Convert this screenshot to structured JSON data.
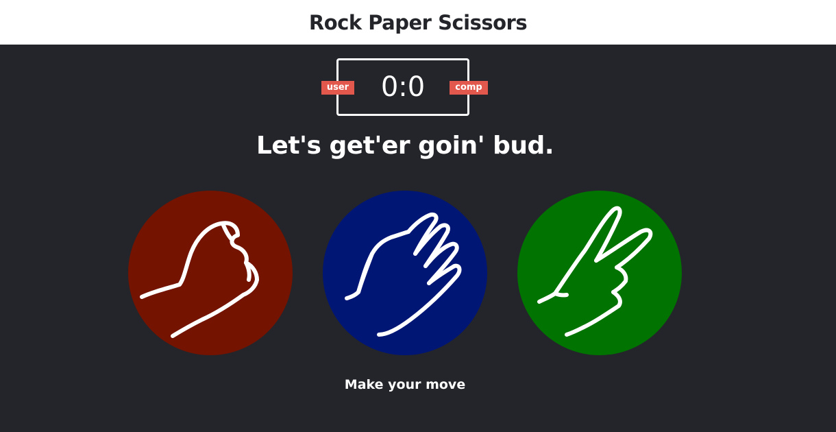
{
  "header": {
    "title": "Rock Paper Scissors"
  },
  "scoreboard": {
    "user_label": "user",
    "comp_label": "comp",
    "score": "0:0",
    "badge_color": "#e2584d"
  },
  "result": {
    "message": "Let's get'er goin' bud."
  },
  "choices": [
    {
      "name": "rock",
      "icon": "fist-icon",
      "color": "#731300"
    },
    {
      "name": "paper",
      "icon": "open-hand-icon",
      "color": "#001675"
    },
    {
      "name": "scissors",
      "icon": "peace-hand-icon",
      "color": "#007300"
    }
  ],
  "action_message": "Make your move"
}
